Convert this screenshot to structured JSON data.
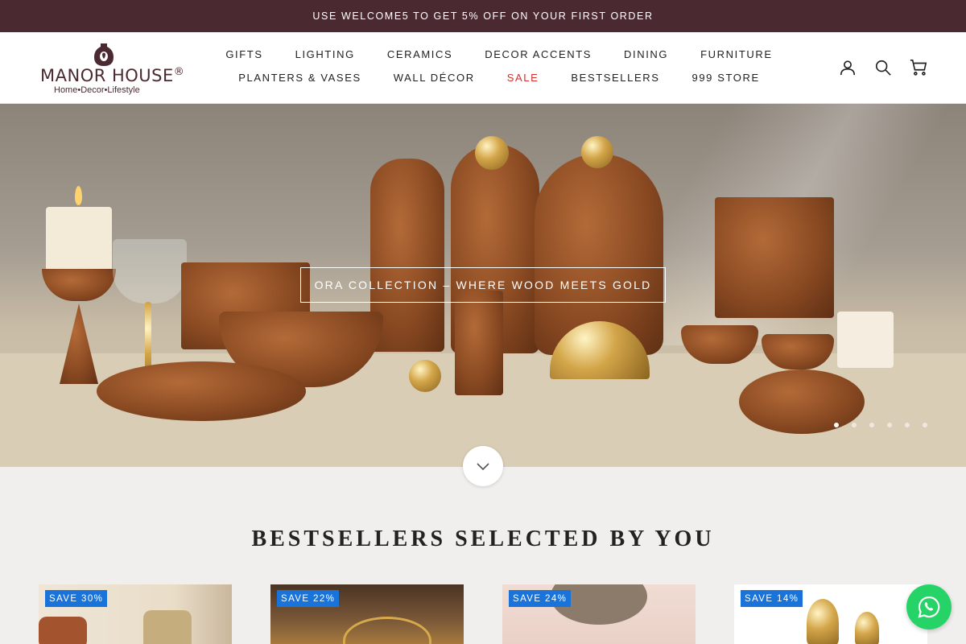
{
  "promo": {
    "text": "USE WELCOME5 TO GET 5% OFF ON YOUR FIRST ORDER"
  },
  "logo": {
    "brand": "MANOR HOUSE",
    "reg": "®",
    "tagline": "Home•Decor•Lifestyle"
  },
  "nav": {
    "row1": [
      "GIFTS",
      "LIGHTING",
      "CERAMICS",
      "DECOR ACCENTS",
      "DINING",
      "FURNITURE"
    ],
    "row2": [
      "PLANTERS & VASES",
      "WALL DÉCOR",
      "SALE",
      "BESTSELLERS",
      "999 STORE"
    ]
  },
  "header_icons": [
    "account-icon",
    "search-icon",
    "cart-icon"
  ],
  "hero": {
    "cta": "ORA COLLECTION – WHERE WOOD MEETS GOLD",
    "slide_count": 6,
    "active_slide": 1
  },
  "section": {
    "title": "BESTSELLERS SELECTED BY YOU"
  },
  "products": [
    {
      "badge": "SAVE 30%"
    },
    {
      "badge": "SAVE 22%"
    },
    {
      "badge": "SAVE 24%"
    },
    {
      "badge": "SAVE 14%"
    }
  ],
  "colors": {
    "promo_bg": "#4a2a30",
    "sale": "#d32f2f",
    "badge": "#1a73d9",
    "whatsapp": "#25d366"
  }
}
